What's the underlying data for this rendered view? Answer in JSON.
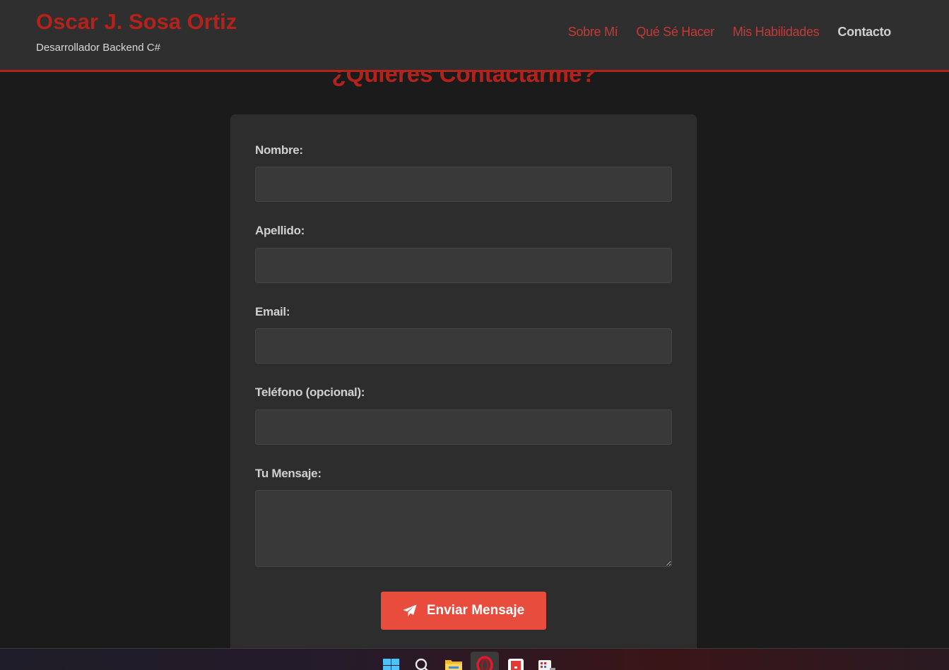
{
  "header": {
    "brand_name": "Oscar J. Sosa Ortiz",
    "tagline": "Desarrollador Backend C#",
    "nav": [
      {
        "label": "Sobre Mí",
        "active": false
      },
      {
        "label": "Qué Sé Hacer",
        "active": false
      },
      {
        "label": "Mis Habilidades",
        "active": false
      },
      {
        "label": "Contacto",
        "active": true
      }
    ]
  },
  "contact": {
    "title": "¿Quieres Contactarme?",
    "fields": [
      {
        "label": "Nombre:",
        "value": "",
        "placeholder": ""
      },
      {
        "label": "Apellido:",
        "value": "",
        "placeholder": ""
      },
      {
        "label": "Email:",
        "value": "",
        "placeholder": ""
      },
      {
        "label": "Teléfono (opcional):",
        "value": "",
        "placeholder": ""
      },
      {
        "label": "Tu Mensaje:",
        "value": "",
        "placeholder": ""
      }
    ],
    "submit_label": "Enviar Mensaje",
    "submit_icon": "paper-plane-icon"
  },
  "taskbar": {
    "icons": [
      "windows-start-icon",
      "search-icon",
      "file-explorer-icon",
      "opera-browser-icon",
      "red-app-icon",
      "photo-app-icon"
    ]
  },
  "colors": {
    "accent": "#b3221b",
    "nav_link": "#c63a36",
    "button": "#e74c3c",
    "background": "#1b1b1b",
    "card": "#2d2d2d",
    "input": "#393939"
  }
}
